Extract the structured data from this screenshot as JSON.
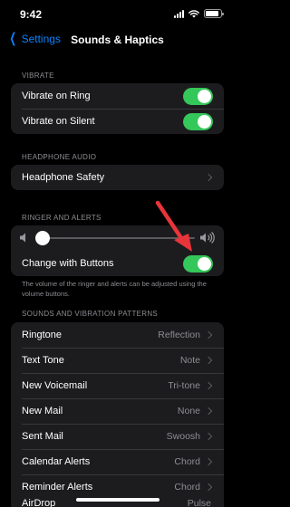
{
  "status_bar": {
    "time": "9:42",
    "battery_level": 0.9
  },
  "nav": {
    "back_label": "Settings",
    "title": "Sounds & Haptics"
  },
  "vibrate": {
    "header": "VIBRATE",
    "items": [
      {
        "label": "Vibrate on Ring",
        "on": true
      },
      {
        "label": "Vibrate on Silent",
        "on": true
      }
    ]
  },
  "headphone": {
    "header": "HEADPHONE AUDIO",
    "items": [
      {
        "label": "Headphone Safety"
      }
    ]
  },
  "ringer": {
    "header": "RINGER AND ALERTS",
    "volume_level": 0.03,
    "change_with_buttons": {
      "label": "Change with Buttons",
      "on": true
    },
    "footnote": "The volume of the ringer and alerts can be adjusted using the volume buttons."
  },
  "patterns": {
    "header": "SOUNDS AND VIBRATION PATTERNS",
    "items": [
      {
        "label": "Ringtone",
        "value": "Reflection"
      },
      {
        "label": "Text Tone",
        "value": "Note"
      },
      {
        "label": "New Voicemail",
        "value": "Tri-tone"
      },
      {
        "label": "New Mail",
        "value": "None"
      },
      {
        "label": "Sent Mail",
        "value": "Swoosh"
      },
      {
        "label": "Calendar Alerts",
        "value": "Chord"
      },
      {
        "label": "Reminder Alerts",
        "value": "Chord"
      },
      {
        "label": "AirDrop",
        "value": "Pulse"
      }
    ]
  },
  "colors": {
    "accent": "#0a84ff",
    "toggle_on": "#34c759",
    "annotation": "#e8353a"
  }
}
